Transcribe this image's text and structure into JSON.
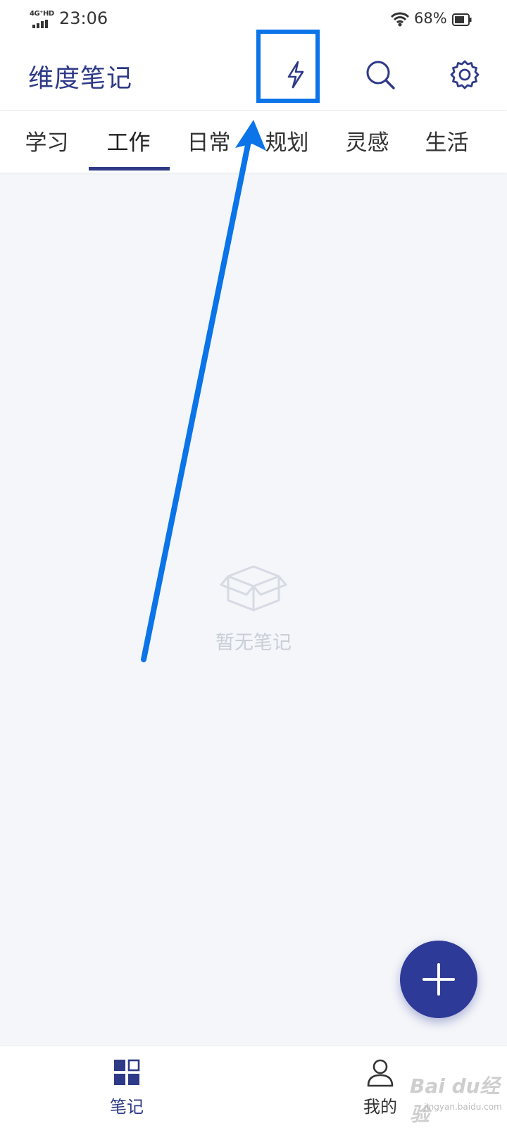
{
  "status_bar": {
    "network": "4G⁺HD",
    "time": "23:06",
    "battery_percent": "68%"
  },
  "app_bar": {
    "title": "维度笔记",
    "icons": [
      "flash-icon",
      "search-icon",
      "settings-icon"
    ]
  },
  "tabs": [
    {
      "label": "学习"
    },
    {
      "label": "工作",
      "active": true
    },
    {
      "label": "日常"
    },
    {
      "label": "规划"
    },
    {
      "label": "灵感"
    },
    {
      "label": "生活"
    }
  ],
  "empty_state": {
    "icon": "empty-box-icon",
    "text": "暂无笔记"
  },
  "fab": {
    "icon": "plus-icon"
  },
  "bottom_nav": {
    "items": [
      {
        "label": "笔记",
        "icon": "grid-icon",
        "active": true
      },
      {
        "label": "我的",
        "icon": "person-icon"
      }
    ]
  },
  "watermark": {
    "main": "Bai du经验",
    "sub": "jingyan.baidu.com"
  },
  "colors": {
    "brand": "#2e3a87",
    "fab": "#2e3a97",
    "annotation": "#0a74e8",
    "background": "#f4f6f9",
    "empty": "#c9ced8"
  }
}
